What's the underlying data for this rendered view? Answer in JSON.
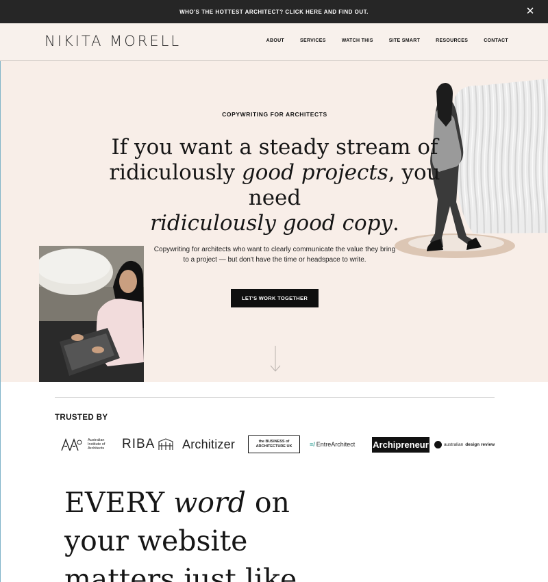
{
  "announcement": {
    "text": "WHO'S THE HOTTEST ARCHITECT? CLICK HERE AND FIND OUT.",
    "close_icon": "close-icon"
  },
  "header": {
    "logo": "NIKITA MORELL",
    "nav": [
      "ABOUT",
      "SERVICES",
      "WATCH THIS",
      "SITE SMART",
      "RESOURCES",
      "CONTACT"
    ]
  },
  "hero": {
    "eyebrow": "COPYWRITING FOR ARCHITECTS",
    "headline_1": "If you want a steady stream of",
    "headline_2a": "ridiculously ",
    "headline_2b": "good projects",
    "headline_2c": ", you need",
    "headline_3": "ridiculously good copy",
    "headline_3_end": ".",
    "subtext": "Copywriting for architects who want to clearly communicate the value they bring to a project — but don't have the time or headspace to write.",
    "cta": "LET'S WORK TOGETHER",
    "scroll_icon": "arrow-down-icon"
  },
  "trusted": {
    "label": "TRUSTED BY",
    "logos": {
      "aia_line1": "Australian",
      "aia_line2": "Institute of",
      "aia_line3": "Architects",
      "riba": "RIBA",
      "architizer": "Architizer",
      "boa_line1": "the BUSINESS of",
      "boa_line2": "ARCHITECTURE UK",
      "entre": "EntreArchitect",
      "archipreneur": "Archipreneur",
      "adr_a": "australian",
      "adr_b": "design review"
    }
  },
  "section": {
    "line1a": "EVERY ",
    "line1b": "word",
    "line1c": " on",
    "line2": "your website",
    "line3": "matters just like"
  },
  "colors": {
    "announce_bg": "#262626",
    "header_bg": "#f8f1ec",
    "hero_bg": "#f8eee8",
    "cta_bg": "#0f0f0f"
  }
}
